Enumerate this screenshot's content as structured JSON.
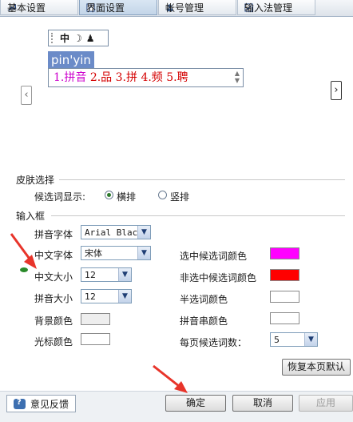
{
  "tabs": [
    {
      "label": "基本设置",
      "icon": "wrench-icon",
      "active": false
    },
    {
      "label": "界面设置",
      "icon": "window-icon",
      "active": true
    },
    {
      "label": "帐号管理",
      "icon": "user-account-icon",
      "active": false
    },
    {
      "label": "输入法管理",
      "icon": "checkbox-icon",
      "active": false
    }
  ],
  "preview": {
    "toolbar": {
      "mode": "中",
      "moon": "☽",
      "person": "♟"
    },
    "pinyin": "pin'yin",
    "candidates": [
      {
        "n": "1.",
        "text": "拼音"
      },
      {
        "n": "2.",
        "text": "品"
      },
      {
        "n": "3.",
        "text": "拼"
      },
      {
        "n": "4.",
        "text": "频"
      },
      {
        "n": "5.",
        "text": "聘"
      }
    ],
    "prev_arrow": "‹",
    "next_arrow": "›"
  },
  "skin": {
    "section": "皮肤选择",
    "candidate_display_label": "候选词显示:",
    "options": [
      {
        "label": "横排",
        "selected": true
      },
      {
        "label": "竖排",
        "selected": false
      }
    ]
  },
  "inputbox": {
    "section": "输入框",
    "pinyin_font_label": "拼音字体",
    "pinyin_font_value": "Arial Black",
    "cn_font_label": "中文字体",
    "cn_font_value": "宋体",
    "cn_size_label": "中文大小",
    "cn_size_value": "12",
    "pinyin_size_label": "拼音大小",
    "pinyin_size_value": "12",
    "bg_color_label": "背景颜色",
    "cursor_color_label": "光标颜色",
    "selected_cand_color_label": "选中候选词颜色",
    "unselected_cand_color_label": "非选中候选词颜色",
    "half_cand_color_label": "半选词颜色",
    "pinyin_string_color_label": "拼音串颜色",
    "per_page_label": "每页候选词数：",
    "per_page_value": "5"
  },
  "colors": {
    "selected_cand": "#ff00ff",
    "unselected_cand": "#ff0000",
    "half_cand": "#ffffff",
    "pinyin_string": "#ffffff",
    "bg": "#eeeeee",
    "cursor": "#ffffff"
  },
  "buttons": {
    "restore": "恢复本页默认",
    "feedback": "意见反馈",
    "ok": "确定",
    "cancel": "取消",
    "apply": "应用"
  }
}
